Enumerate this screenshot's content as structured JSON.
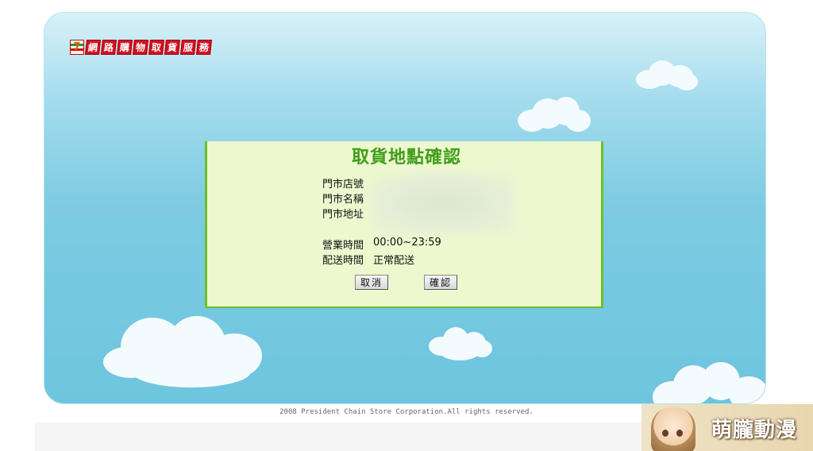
{
  "logo": {
    "seven": "7",
    "chars": [
      "網",
      "路",
      "購",
      "物",
      "取",
      "貨",
      "服",
      "務"
    ]
  },
  "dialog": {
    "title": "取貨地點確認",
    "labels": {
      "store_id": "門市店號",
      "store_name": "門市名稱",
      "store_address": "門市地址",
      "business_hours": "營業時間",
      "delivery_time": "配送時間"
    },
    "values": {
      "business_hours": "00:00~23:59",
      "delivery_time": "正常配送"
    },
    "buttons": {
      "cancel": "取消",
      "confirm": "確認"
    }
  },
  "footer": {
    "copyright": "2008 President Chain Store Corporation.All rights reserved."
  },
  "watermark": {
    "brand": "萌朧動漫"
  },
  "colors": {
    "panel_bg": "#edf8cf",
    "panel_border": "#6cc024",
    "title": "#3e9e18",
    "logo_red": "#d8101e"
  }
}
